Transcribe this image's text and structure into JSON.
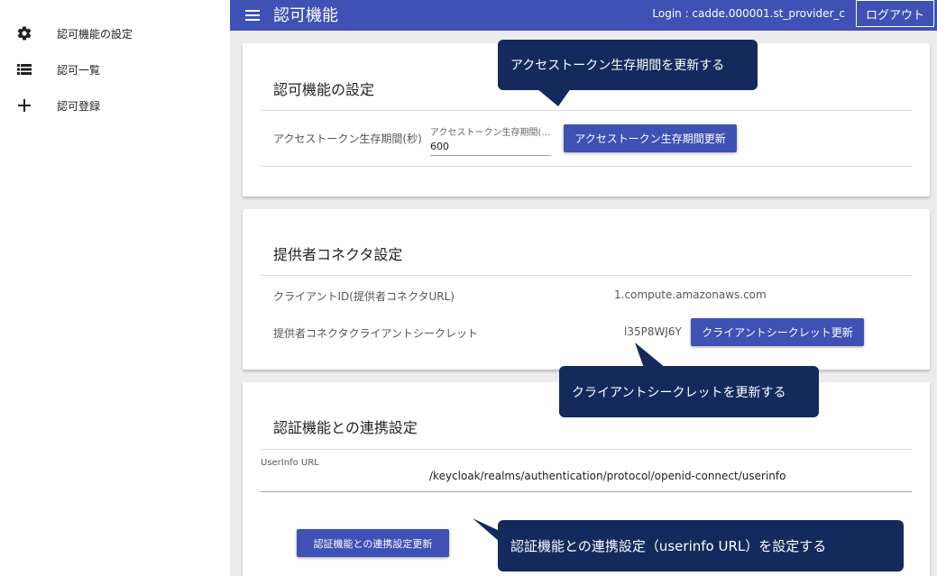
{
  "sidebar": {
    "items": [
      {
        "label": "認可機能の設定",
        "icon": "gear-icon"
      },
      {
        "label": "認可一覧",
        "icon": "list-icon"
      },
      {
        "label": "認可登録",
        "icon": "plus-icon"
      }
    ]
  },
  "header": {
    "title": "認可機能",
    "login": "Login : cadde.000001.st_provider_c",
    "logout_label": "ログアウト"
  },
  "auth_settings": {
    "title": "認可機能の設定",
    "token_label": "アクセストークン生存期間(秒)",
    "token_field_label": "アクセストークン生存期間(…",
    "token_value": "600",
    "update_button": "アクセストークン生存期間更新"
  },
  "connector_settings": {
    "title": "提供者コネクタ設定",
    "client_id_label": "クライアントID(提供者コネクタURL)",
    "client_id_value": "1.compute.amazonaws.com",
    "secret_label": "提供者コネクタクライアントシークレット",
    "secret_value": "l35P8WJ6Y",
    "secret_update_button": "クライアントシークレット更新"
  },
  "auth_link_settings": {
    "title": "認証機能との連携設定",
    "userinfo_label": "UserInfo URL",
    "userinfo_value": "/keycloak/realms/authentication/protocol/openid-connect/userinfo",
    "update_button": "認証機能との連携設定更新"
  },
  "callouts": {
    "token": "アクセストークン生存期間を更新する",
    "secret": "クライアントシークレットを更新する",
    "userinfo": "認証機能との連携設定（userinfo URL）を設定する"
  },
  "colors": {
    "primary": "#3f51b5",
    "callout": "#142a5c"
  }
}
